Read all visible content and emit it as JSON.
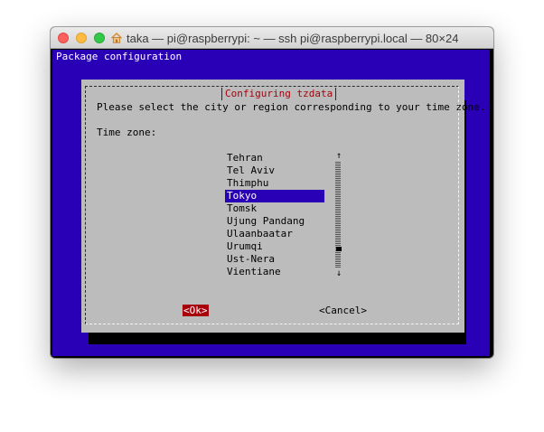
{
  "window": {
    "title": "taka — pi@raspberrypi: ~ — ssh pi@raspberrypi.local — 80×24",
    "title_icon": "home-icon",
    "traffic_lights": {
      "close": "#fc605c",
      "minimize": "#fdbc40",
      "maximize": "#34c84a"
    }
  },
  "terminal": {
    "header": "Package configuration",
    "background": "#2900b5"
  },
  "dialog": {
    "title": "Configuring tzdata",
    "prompt": "Please select the city or region corresponding to your time zone.",
    "field_label": "Time zone:",
    "items": [
      {
        "label": "Tehran",
        "selected": false
      },
      {
        "label": "Tel Aviv",
        "selected": false
      },
      {
        "label": "Thimphu",
        "selected": false
      },
      {
        "label": "Tokyo",
        "selected": true
      },
      {
        "label": "Tomsk",
        "selected": false
      },
      {
        "label": "Ujung Pandang",
        "selected": false
      },
      {
        "label": "Ulaanbaatar",
        "selected": false
      },
      {
        "label": "Urumqi",
        "selected": false
      },
      {
        "label": "Ust-Nera",
        "selected": false
      },
      {
        "label": "Vientiane",
        "selected": false
      }
    ],
    "scroll": {
      "up_arrow": "↑",
      "down_arrow": "↓",
      "position": 0.84
    },
    "ok_label": "<Ok>",
    "cancel_label": "<Cancel>",
    "colors": {
      "title": "#a8000b",
      "selection": "#2900b5",
      "ok_focus": "#a8000b"
    }
  }
}
